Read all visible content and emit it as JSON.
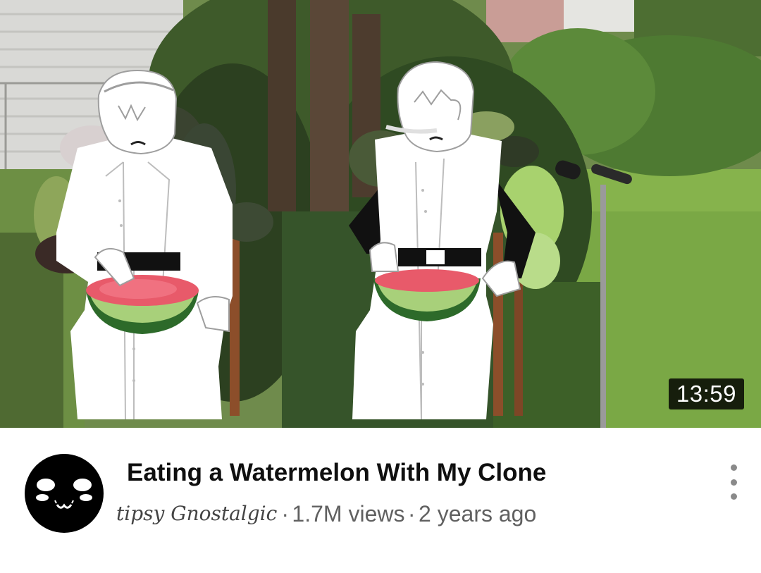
{
  "video": {
    "duration": "13:59",
    "title": "Eating a Watermelon With My Clone",
    "channel": "tipsy Gnostalgic",
    "separator": "·",
    "views": "1.7M views",
    "age": "2 years ago"
  },
  "icons": {
    "avatar": "channel-avatar-icon",
    "menu": "more-vert-icon"
  },
  "colors": {
    "title": "#0f0f0f",
    "meta": "#606060",
    "duration_bg": "#000000",
    "avatar": "#000000"
  }
}
